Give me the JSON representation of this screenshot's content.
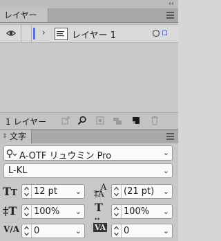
{
  "collapse_glyph": "‹‹",
  "layers": {
    "tab_label": "レイヤー",
    "layer_name": "レイヤー 1",
    "layer_color": "#4f6ef7",
    "status_text": "1 レイヤー"
  },
  "character": {
    "tab_label": "文字",
    "font_family": "A-OTF リュウミン Pro",
    "font_style": "L-KL",
    "font_size": "12 pt",
    "leading": "(21 pt)",
    "vertical_scale": "100%",
    "horizontal_scale": "100%",
    "kerning": "0",
    "tracking": "0"
  },
  "icons": [
    "eye-icon",
    "disclosure-arrow-icon",
    "target-circle-icon",
    "selection-square-icon",
    "export-icon",
    "search-icon",
    "clipping-mask-icon",
    "sublayer-icon",
    "new-layer-icon",
    "trash-icon",
    "font-size-icon",
    "leading-icon",
    "vertical-scale-icon",
    "horizontal-scale-icon",
    "kerning-icon",
    "tracking-icon",
    "panel-menu-icon"
  ]
}
